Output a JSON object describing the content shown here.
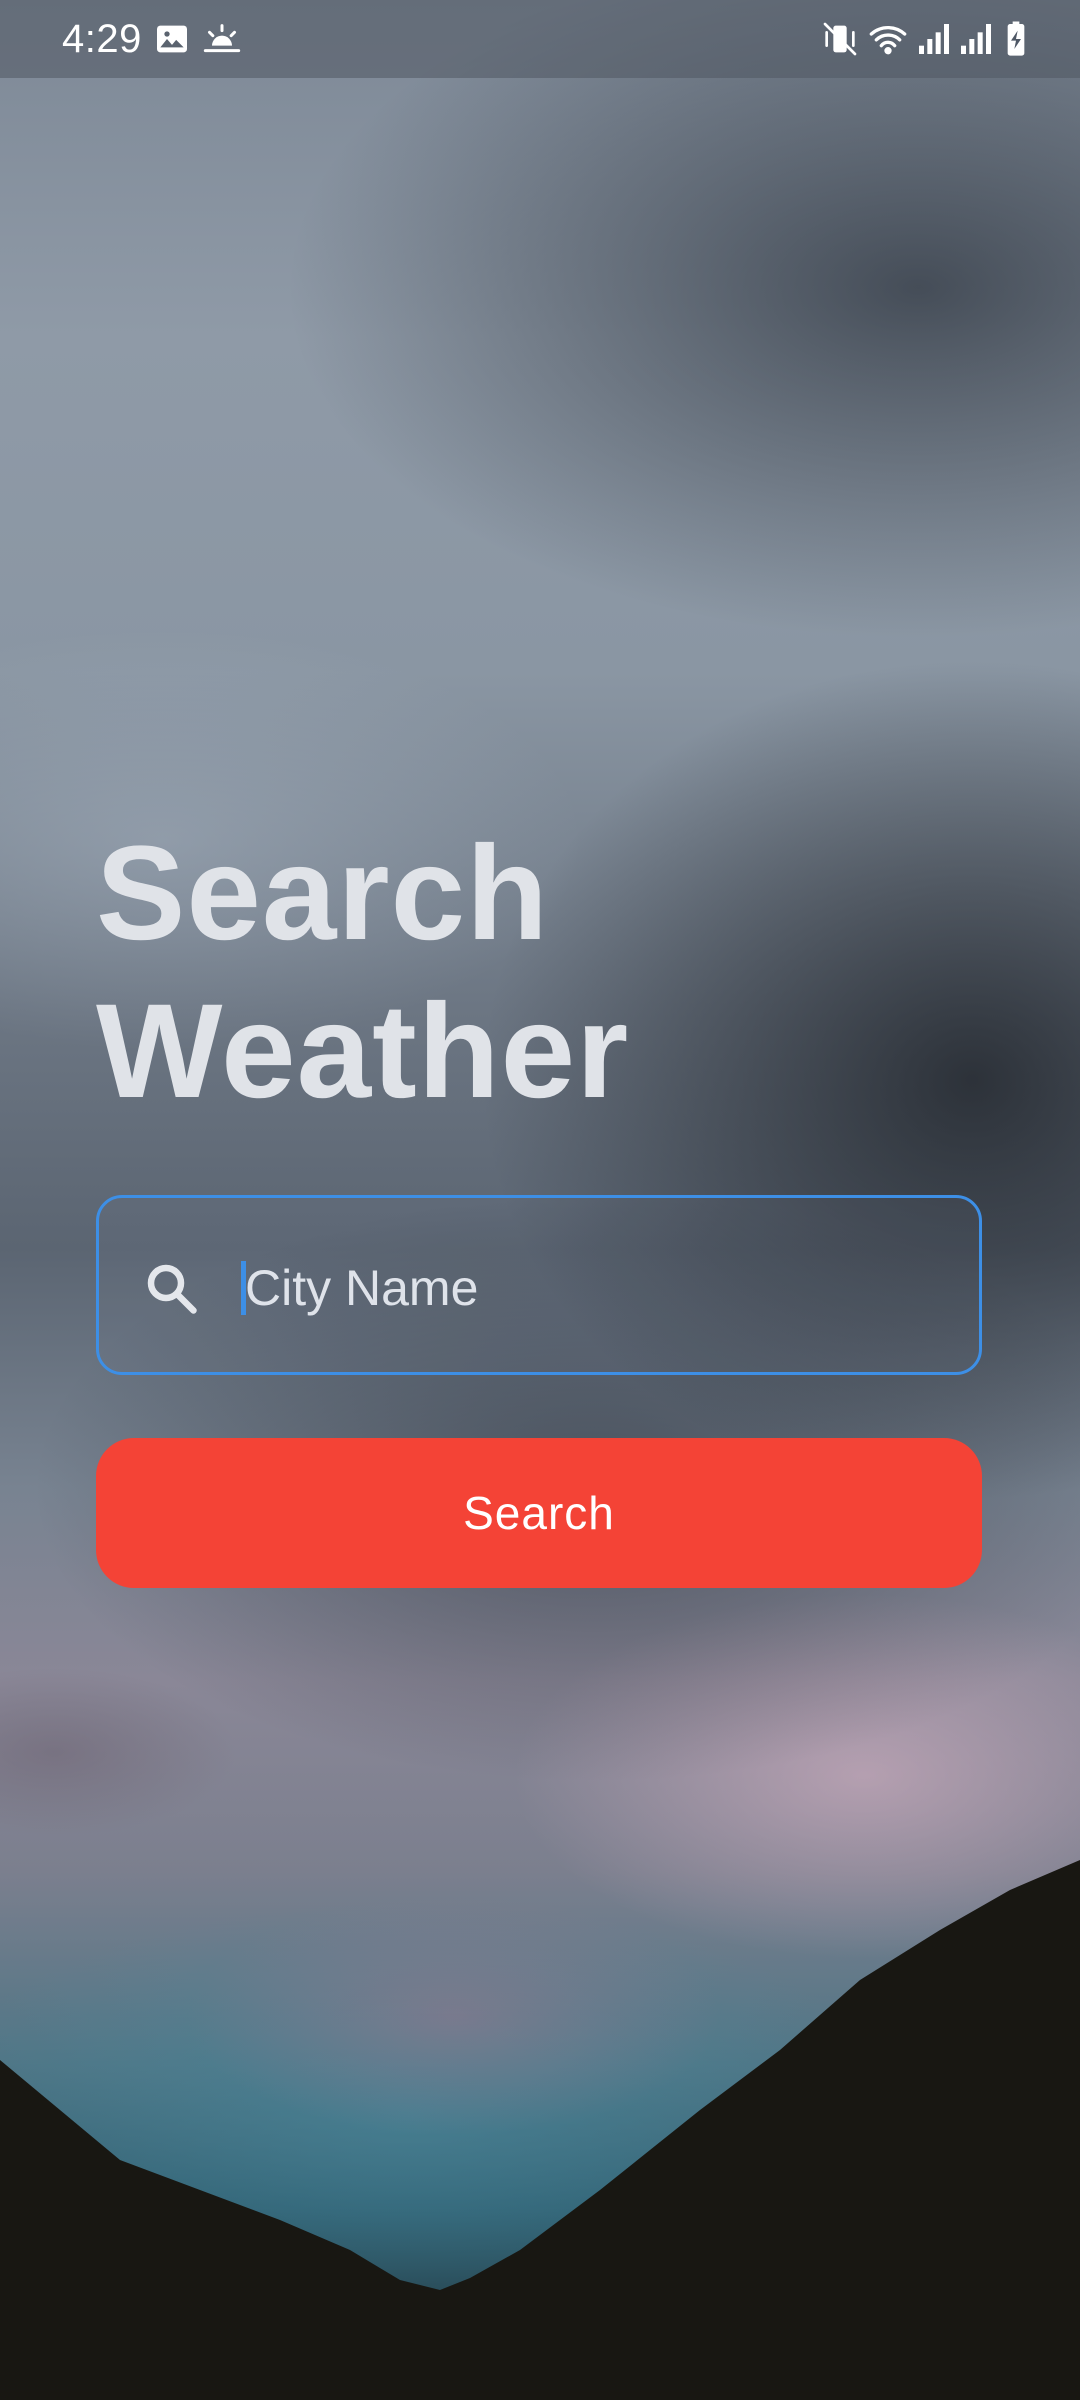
{
  "status_bar": {
    "time": "4:29",
    "left_icons": [
      "image-icon",
      "weather-sunrise-icon"
    ],
    "right_icons": [
      "vibrate-mute-icon",
      "wifi-icon",
      "signal-icon",
      "signal-icon",
      "battery-charging-icon"
    ]
  },
  "title": {
    "line1": "Search",
    "line2": "Weather"
  },
  "search": {
    "placeholder": "City Name",
    "value": "",
    "icon": "search-icon",
    "border_color": "#3d8fe6"
  },
  "button": {
    "label": "Search",
    "color": "#f44336"
  }
}
